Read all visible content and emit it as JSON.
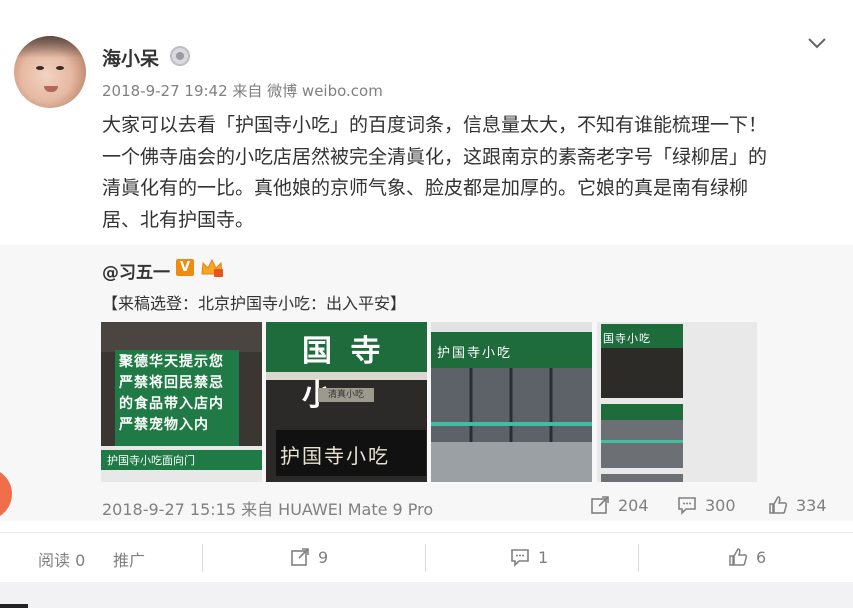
{
  "post": {
    "username": "海小呆",
    "meta": "2018-9-27 19:42 来自 微博 weibo.com",
    "lines": [
      "大家可以去看「护国寺小吃」的百度词条，信息量太大，不知有谁能梳理一下！",
      "一个佛寺庙会的小吃店居然被完全清眞化，这跟南京的素斋老字号「绿柳居」的",
      "清眞化有的一比。真他娘的京师气象、脸皮都是加厚的。它娘的真是南有绿柳",
      "居、北有护国寺。"
    ]
  },
  "repost": {
    "author": "@习五一",
    "v_badge": "V",
    "text": "【来稿选登：北京护国寺小吃：出入平安】",
    "images": [
      {
        "sign_lines": [
          "聚德华天提示您",
          "严禁将回民禁忌",
          "的食品带入店内",
          "严禁宠物入内"
        ],
        "banner": "护国寺小吃面向门"
      },
      {
        "top_chars": "国 寺 小",
        "small_sign": "清真小吃",
        "plaque": "护国寺小吃"
      },
      {
        "banner": "护国寺小吃"
      },
      {
        "banner": "国寺小吃"
      }
    ],
    "meta": "2018-9-27 15:15 来自 HUAWEI Mate 9 Pro",
    "stats": {
      "reposts": "204",
      "comments": "300",
      "likes": "334"
    }
  },
  "footer": {
    "read": "阅读 0",
    "promote": "推广",
    "reposts": "9",
    "comments": "1",
    "likes": "6"
  },
  "icons": [
    "verified-crown-icon",
    "chevron-down-icon",
    "repost-icon",
    "comment-icon",
    "like-icon",
    "vip-crown-icon"
  ],
  "colors": {
    "accent_orange": "#f08b12",
    "sign_green": "#1e6b3c",
    "plaque_black": "#1a1a1a"
  }
}
